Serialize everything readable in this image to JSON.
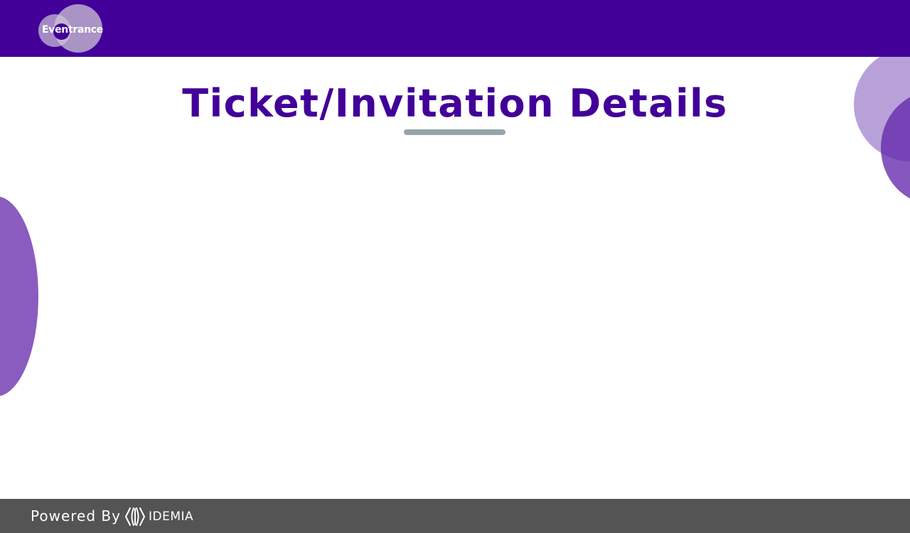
{
  "header": {
    "logo_text": "Eventrance",
    "background_color": "#420099"
  },
  "main": {
    "title": "Ticket/Invitation Details",
    "title_color": "#420099",
    "underline_color": "#95a5ab"
  },
  "footer": {
    "powered_by_label": "Powered By",
    "brand_name": "IDEMIA",
    "brand_icon": "idemia-logo-icon",
    "background_color": "#545454"
  },
  "decor": {
    "accent_light": "#b8a1d9",
    "accent_dark": "#6428aa",
    "accent_left": "#8a5cc0"
  }
}
